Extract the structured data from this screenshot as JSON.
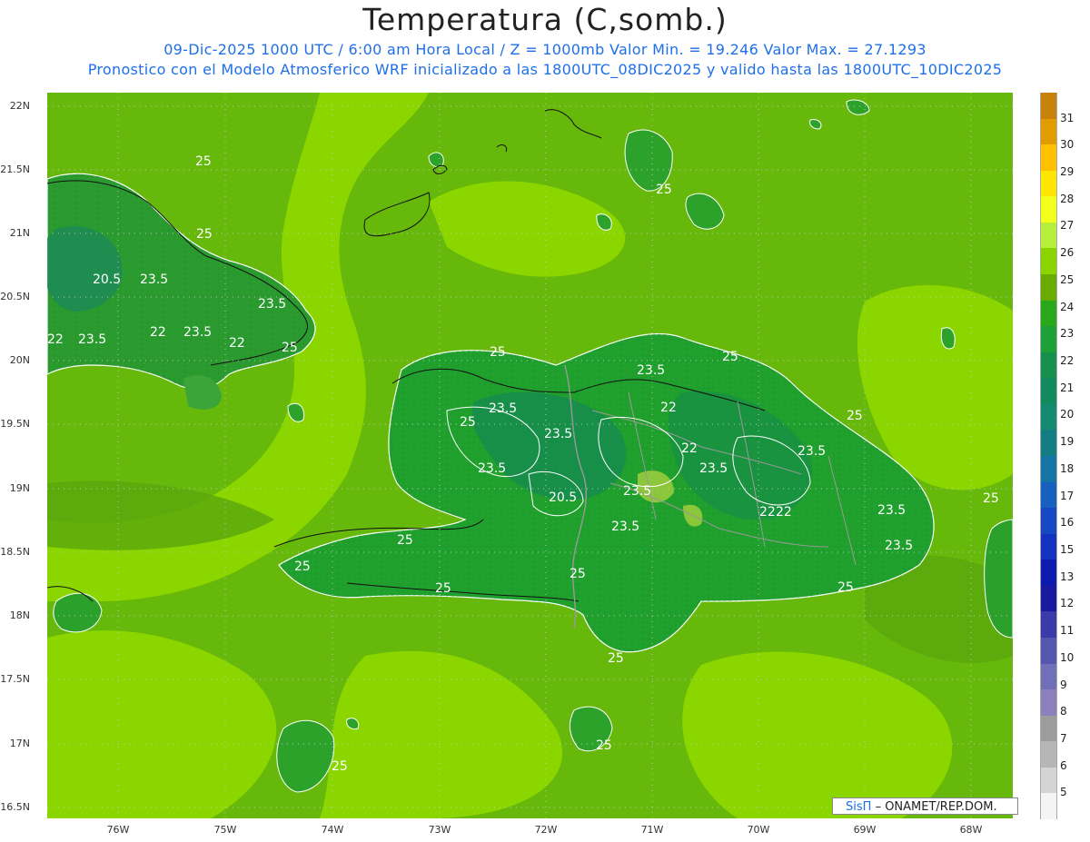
{
  "title": "Temperatura (C,somb.)",
  "subtitle_1": "09-Dic-2025  1000 UTC / 6:00 am Hora Local / Z = 1000mb     Valor Min. = 19.246  Valor Max. = 27.1293",
  "subtitle_2": "Pronostico con el Modelo Atmosferico WRF inicializado a las 1800UTC_08DIC2025 y valido hasta las  1800UTC_10DIC2025",
  "lat_labels": [
    "22N",
    "21.5N",
    "21N",
    "20.5N",
    "20N",
    "19.5N",
    "19N",
    "18.5N",
    "18N",
    "17.5N",
    "17N",
    "16.5N"
  ],
  "lon_labels": [
    "76W",
    "75W",
    "74W",
    "73W",
    "72W",
    "71W",
    "70W",
    "69W",
    "68W"
  ],
  "contour_labels": [
    "25",
    "25",
    "25",
    "25",
    "25",
    "25",
    "25",
    "25",
    "25",
    "25",
    "25",
    "25",
    "25",
    "25",
    "25",
    "25",
    "25",
    "23.5",
    "23.5",
    "23.5",
    "23.5",
    "23.5",
    "23.5",
    "23.5",
    "23.5",
    "23.5",
    "23.5",
    "23.5",
    "23.5",
    "23.5",
    "23.5",
    "22",
    "22",
    "22",
    "22",
    "22",
    "22",
    "22",
    "20.5",
    "20.5"
  ],
  "colorbar": {
    "labels": [
      "31",
      "30",
      "29",
      "28",
      "27",
      "26",
      "25",
      "24",
      "23",
      "22",
      "21",
      "20",
      "19",
      "18",
      "17",
      "16",
      "15",
      "13",
      "12",
      "11",
      "10",
      "9",
      "8",
      "7",
      "6",
      "5"
    ],
    "colors": [
      "#c8820a",
      "#e29b00",
      "#ffc000",
      "#ffe600",
      "#f2ff1a",
      "#b6ef3a",
      "#8ad400",
      "#6aab00",
      "#2aa81c",
      "#1ea038",
      "#178f4d",
      "#138a5e",
      "#148a70",
      "#127e83",
      "#1574a6",
      "#1660c0",
      "#1548c2",
      "#1232bf",
      "#0c1aad",
      "#1a1aa0",
      "#3a3aa8",
      "#5656b0",
      "#7070b8",
      "#8d7fbc",
      "#9c9c9c",
      "#b6b6b6",
      "#d4d4d4",
      "#f4f4f4"
    ]
  },
  "credit": {
    "brand": "SisΠ",
    "text": "– ONAMET/REP.DOM."
  },
  "colors": {
    "land_dark": "#2b9a24",
    "land_mid": "#3aa53a",
    "sea": "#66b80a",
    "sea_light": "#8cd600"
  }
}
